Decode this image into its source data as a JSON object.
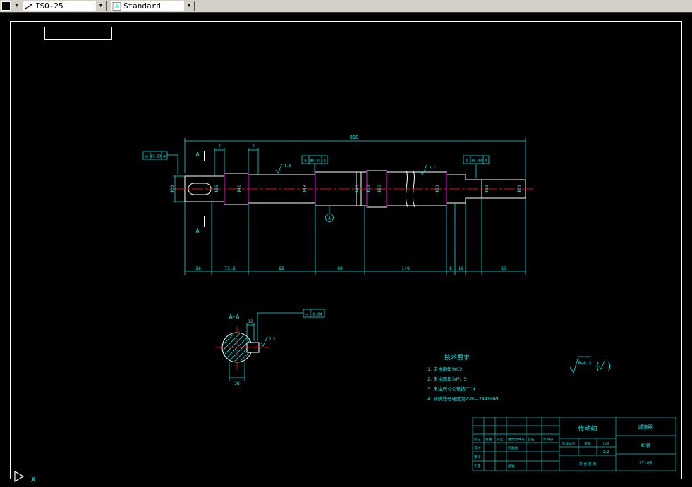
{
  "colors": {
    "background": "#000000",
    "line": "#ffffff",
    "dimension": "#00e8e8",
    "centerline": "#ff0000",
    "step_line": "#ff00ff",
    "toolbar_bg": "#d4d0c8"
  },
  "toolbar": {
    "dim_style": "ISO-25",
    "text_style": "Standard"
  },
  "icons": {
    "combo_arrow": "▼",
    "overflow_arrow": "▼",
    "text_style_glyph": "A"
  },
  "drawing": {
    "overall_dim": "500",
    "chamfer_dims": [
      "2",
      "2"
    ],
    "gdt_frames": [
      {
        "symbol": "◎",
        "tolerance": "Φ0.03",
        "datum": "A"
      },
      {
        "symbol": "◎",
        "tolerance": "Φ0.04",
        "datum": "A"
      },
      {
        "symbol": "◎",
        "tolerance": "Φ0.04",
        "datum": "A"
      }
    ],
    "section_cut_label": "A",
    "datum_label": "A",
    "surface_finish": [
      "1.6",
      "3.2"
    ],
    "diameter_labels": [
      "Φ30",
      "Φ36",
      "Φ42",
      "Φ40",
      "Φ45",
      "Φ50",
      "Φ52",
      "Φ50",
      "Φ38",
      "Φ28"
    ],
    "length_dims": [
      "38",
      "73.5",
      "55",
      "80",
      "140",
      "8",
      "10",
      "59"
    ]
  },
  "section_view": {
    "label": "A-A",
    "keyway_width": "12",
    "keyway_depth": "38",
    "surface_finish": "6.3",
    "gdt": {
      "symbol": "=",
      "tolerance": "0.04"
    }
  },
  "tech_requirements": {
    "title": "技术要求",
    "lines": [
      "1. 未注倒角为C2",
      "2. 未注圆角为R1.5",
      "3. 未注尺寸公差按IT14",
      "4. 调质处理硬度为228—244HBW"
    ]
  },
  "surface_note": {
    "value": "Ra6.3",
    "paren_open": "(",
    "paren_close": ")"
  },
  "title_block": {
    "part_name": "传动轴",
    "org_name": "减速器",
    "material": "45钢",
    "drawing_no": "JT-05",
    "col_headers": [
      "标记",
      "处数",
      "分区",
      "更改文件号",
      "签名",
      "年月日"
    ],
    "row_labels": [
      "设计",
      "标准化",
      "审核",
      "工艺",
      "批准"
    ],
    "mid_labels": [
      "阶段标记",
      "重量",
      "比例"
    ],
    "scale": "1:2",
    "sheet_info": "共 张 第 张"
  },
  "ucs": {
    "axis_label": "X"
  }
}
